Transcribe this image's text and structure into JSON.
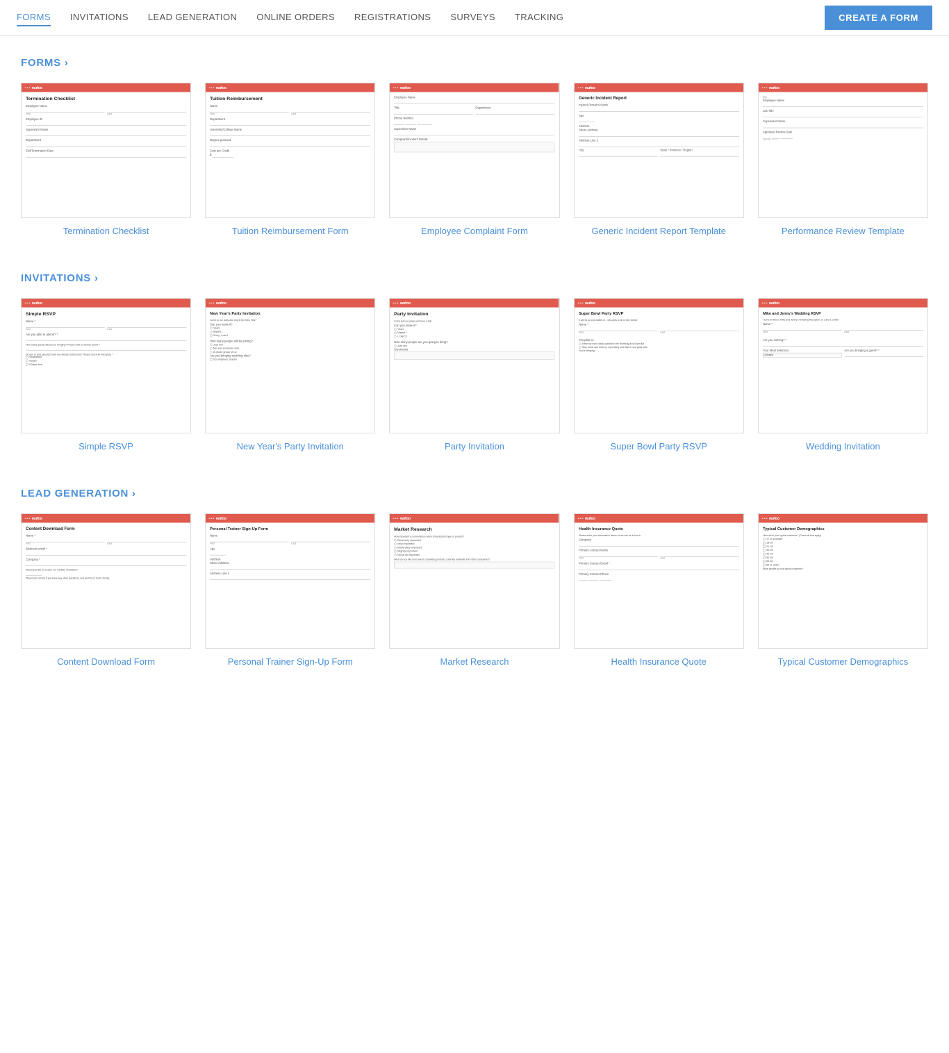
{
  "nav": {
    "links": [
      {
        "label": "FORMS",
        "active": true
      },
      {
        "label": "INVITATIONS",
        "active": false
      },
      {
        "label": "LEAD GENERATION",
        "active": false
      },
      {
        "label": "ONLINE ORDERS",
        "active": false
      },
      {
        "label": "REGISTRATIONS",
        "active": false
      },
      {
        "label": "SURVEYS",
        "active": false
      },
      {
        "label": "TRACKING",
        "active": false
      }
    ],
    "cta": "CREATE A FORM"
  },
  "sections": [
    {
      "id": "forms",
      "title": "FORMS ›",
      "cards": [
        {
          "label": "Termination Checklist",
          "type": "termination"
        },
        {
          "label": "Tuition Reimbursement Form",
          "type": "tuition"
        },
        {
          "label": "Employee Complaint Form",
          "type": "complaint"
        },
        {
          "label": "Generic Incident Report Template",
          "type": "incident"
        },
        {
          "label": "Performance Review Template",
          "type": "performance"
        }
      ]
    },
    {
      "id": "invitations",
      "title": "INVITATIONS ›",
      "cards": [
        {
          "label": "Simple RSVP",
          "type": "rsvp"
        },
        {
          "label": "New Year's Party Invitation",
          "type": "newyear"
        },
        {
          "label": "Party Invitation",
          "type": "party"
        },
        {
          "label": "Super Bowl Party RSVP",
          "type": "superbowl"
        },
        {
          "label": "Wedding Invitation",
          "type": "wedding"
        }
      ]
    },
    {
      "id": "lead",
      "title": "LEAD GENERATION ›",
      "cards": [
        {
          "label": "Content Download Form",
          "type": "content"
        },
        {
          "label": "Personal Trainer Sign-Up Form",
          "type": "trainer"
        },
        {
          "label": "Market Research",
          "type": "market"
        },
        {
          "label": "Health Insurance Quote",
          "type": "health"
        },
        {
          "label": "Typical Customer Demographics",
          "type": "demographics"
        }
      ]
    }
  ]
}
